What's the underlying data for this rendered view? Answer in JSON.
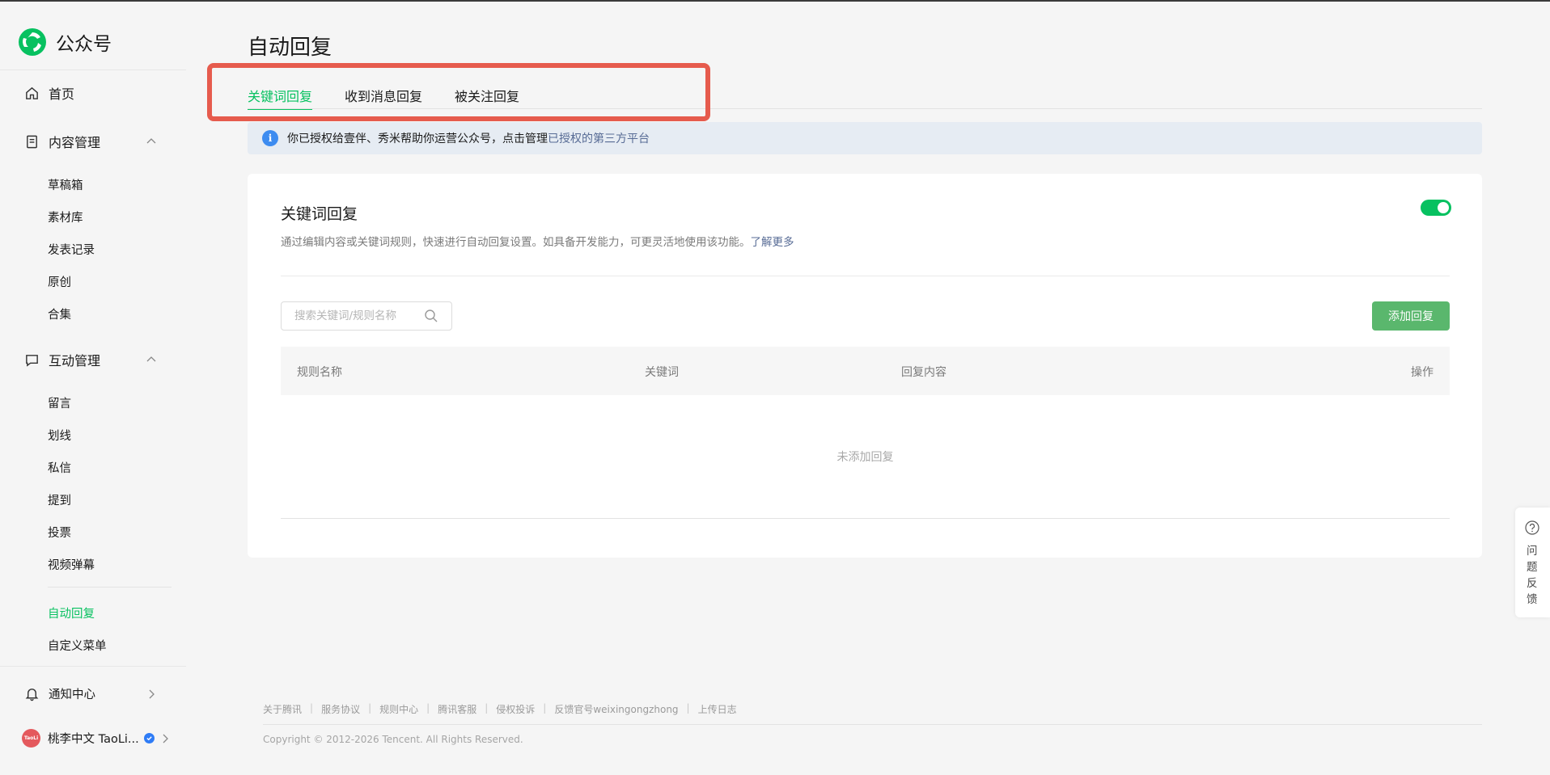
{
  "brand": {
    "name": "公众号"
  },
  "nav": {
    "home": "首页",
    "content": {
      "label": "内容管理",
      "items": [
        "草稿箱",
        "素材库",
        "发表记录",
        "原创",
        "合集"
      ]
    },
    "interact": {
      "label": "互动管理",
      "items": [
        "留言",
        "划线",
        "私信",
        "提到",
        "投票",
        "视频弹幕"
      ]
    },
    "extra": [
      "自动回复",
      "自定义菜单"
    ],
    "notify": "通知中心",
    "account_name": "桃李中文 TaoLi...",
    "avatar_text": "TaoLi"
  },
  "page": {
    "title": "自动回复",
    "tabs": [
      "关键词回复",
      "收到消息回复",
      "被关注回复"
    ]
  },
  "notice": {
    "text": "你已授权给壹伴、秀米帮助你运营公众号，点击管理",
    "link": "已授权的第三方平台"
  },
  "card": {
    "title": "关键词回复",
    "desc": "通过编辑内容或关键词规则，快速进行自动回复设置。如具备开发能力，可更灵活地使用该功能。",
    "desc_link": "了解更多",
    "search_placeholder": "搜索关键词/规则名称",
    "add_button": "添加回复",
    "columns": [
      "规则名称",
      "关键词",
      "回复内容",
      "操作"
    ],
    "empty": "未添加回复"
  },
  "footer": {
    "links": [
      "关于腾讯",
      "服务协议",
      "规则中心",
      "腾讯客服",
      "侵权投诉",
      "反馈官号weixingongzhong",
      "上传日志"
    ],
    "copyright": "Copyright © 2012-2026 Tencent. All Rights Reserved."
  },
  "feedback": {
    "label": "问题反馈"
  },
  "colors": {
    "accent": "#07c160",
    "link": "#576b95",
    "highlight": "#e65b4d"
  }
}
